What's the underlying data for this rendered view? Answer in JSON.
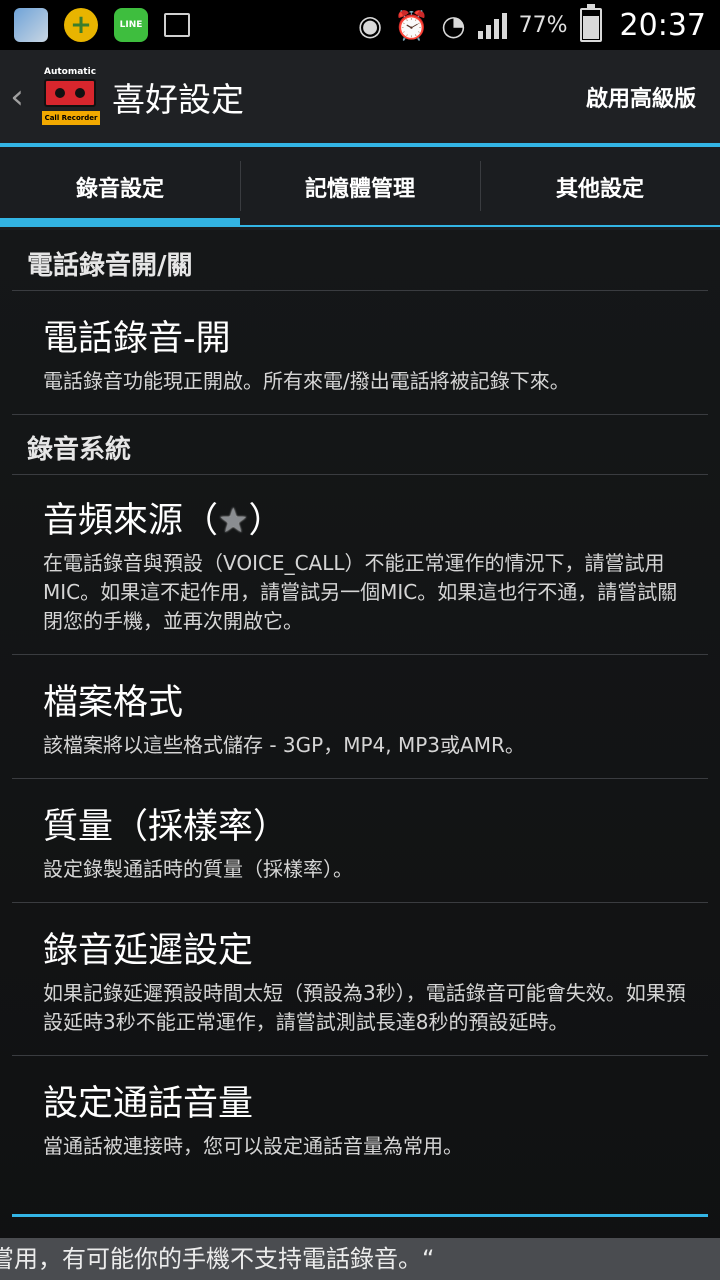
{
  "status_bar": {
    "line_icon": "LINE",
    "battery_percent": "77%",
    "time": "20:37"
  },
  "action_bar": {
    "back": "‹",
    "logo_top": "Automatic",
    "logo_bottom": "Call Recorder",
    "title": "喜好設定",
    "premium": "啟用高級版"
  },
  "tabs": [
    {
      "label": "錄音設定",
      "selected": true
    },
    {
      "label": "記憶體管理",
      "selected": false
    },
    {
      "label": "其他設定",
      "selected": false
    }
  ],
  "categories": {
    "call_recording": "電話錄音開/關",
    "recording_system": "錄音系統"
  },
  "prefs": {
    "recording_on": {
      "title": "電話錄音-開",
      "summary": "電話錄音功能現正開啟。所有來電/撥出電話將被記錄下來。"
    },
    "audio_source": {
      "title_prefix": "音頻來源（",
      "title_star": "★",
      "title_suffix": "）",
      "summary": "在電話錄音與預設（VOICE_CALL）不能正常運作的情況下，請嘗試用MIC。如果這不起作用，請嘗試另一個MIC。如果這也行不通，請嘗試關閉您的手機，並再次開啟它。"
    },
    "file_format": {
      "title": "檔案格式",
      "summary": "該檔案將以這些格式儲存 - 3GP，MP4, MP3或AMR。"
    },
    "quality": {
      "title": "質量（採樣率）",
      "summary": "設定錄製通話時的質量（採樣率）。"
    },
    "delay": {
      "title": "錄音延遲設定",
      "summary": "如果記錄延遲預設時間太短（預設為3秒），電話錄音可能會失效。如果預設延時3秒不能正常運作，請嘗試測試長達8秒的預設延時。"
    },
    "call_volume": {
      "title": "設定通話音量",
      "summary": "當通話被連接時，您可以設定通話音量為常用。"
    }
  },
  "toast": "嘗用，有可能你的手機不支持電話錄音。“"
}
